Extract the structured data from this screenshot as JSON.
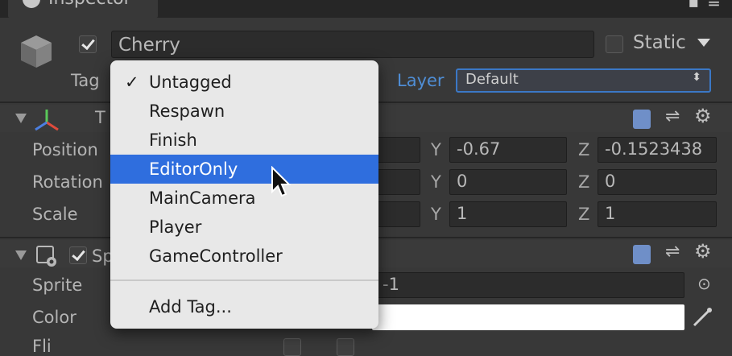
{
  "tab": {
    "label": "Inspector"
  },
  "gameobject": {
    "name": "Cherry",
    "static_label": "Static",
    "tag_label": "Tag",
    "layer_label": "Layer",
    "layer_value": "Default"
  },
  "transform": {
    "title": "T",
    "rows": [
      {
        "label": "Position",
        "y": "-0.67",
        "z": "-0.1523438"
      },
      {
        "label": "Rotation",
        "y": "0",
        "z": "0"
      },
      {
        "label": "Scale",
        "y": "1",
        "z": "1"
      }
    ],
    "y_label": "Y",
    "z_label": "Z"
  },
  "sprite_renderer": {
    "title": "Sp",
    "sprite_label": "Sprite",
    "sprite_value": "1",
    "color_label": "Color",
    "flip_label": "Fli"
  },
  "tag_menu": {
    "items": [
      "Untagged",
      "Respawn",
      "Finish",
      "EditorOnly",
      "MainCamera",
      "Player",
      "GameController"
    ],
    "checked": "Untagged",
    "highlighted": "EditorOnly",
    "add_tag": "Add Tag...",
    "check_mark": "✓"
  },
  "colors": {
    "highlight": "#2f6ede",
    "layer_accent": "#4f8ed6"
  }
}
